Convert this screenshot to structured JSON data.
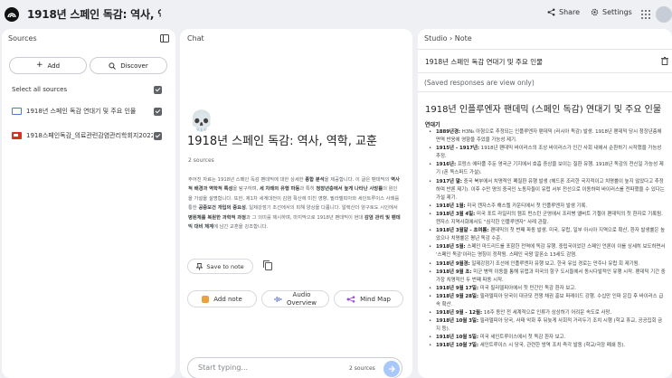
{
  "header": {
    "title": "1918년 스페인 독감: 역사, 역학, 교훈",
    "share_label": "Share",
    "settings_label": "Settings"
  },
  "sources": {
    "title": "Sources",
    "add_label": "Add",
    "discover_label": "Discover",
    "select_all_label": "Select all sources",
    "items": [
      {
        "name": "1918년 스페인 독감 연대기 및 주요 인물",
        "type": "web"
      },
      {
        "name": "1918스페인독감_의료관련감염관리학회지2022...",
        "type": "pdf"
      }
    ]
  },
  "chat": {
    "title": "Chat",
    "emoji": "💀",
    "heading": "1918년 스페인 독감: 역사, 역학, 교훈",
    "source_count": "2 sources",
    "summary_segments": [
      {
        "t": "주어진 자료는 1918년 스페인 독감 팬데믹에 대한 상세한 ",
        "b": false
      },
      {
        "t": "종합 분석",
        "b": true
      },
      {
        "t": "을 제공합니다. 이 글은 팬데믹의 ",
        "b": false
      },
      {
        "t": "역사적 배경과 역학적 특성",
        "b": true
      },
      {
        "t": "을 탐구하며, ",
        "b": false
      },
      {
        "t": "세 차례의 유행 파동",
        "b": true
      },
      {
        "t": "과 특히 ",
        "b": false
      },
      {
        "t": "청장년층에서 높게 나타난 사망률",
        "b": true
      },
      {
        "t": "의 원인을 가설을 설명합니다. 또한, 제1차 세계대전이 감염 확산에 미친 영향, 필라델피아와 세인트루이스 사례를 통한 ",
        "b": false
      },
      {
        "t": "공중보건 개입의 중요성",
        "b": true
      },
      {
        "t": ", 일제강점기 조선에서의 피해 양상을 다룹니다. 알렉산더 양구토도 시인에서 ",
        "b": false
      },
      {
        "t": "병원체를 복원한 과학적 과정",
        "b": true
      },
      {
        "t": "과 그 의미를 제시하며, 마지막으로 1918년 팬데믹이 현대 ",
        "b": false
      },
      {
        "t": "감염 관리 및 팬데믹 대비 체계",
        "b": true
      },
      {
        "t": "에 남긴 교훈을 강조합니다.",
        "b": false
      }
    ],
    "save_note_label": "Save to note",
    "chips": {
      "add_note": "Add note",
      "audio_line1": "Audio",
      "audio_line2": "Overview",
      "mind_map": "Mind Map"
    },
    "input_placeholder": "Start typing...",
    "input_source_count": "2 sources"
  },
  "studio": {
    "crumb_studio": "Studio",
    "crumb_sep": "›",
    "crumb_note": "Note",
    "note_title": "1918년 스페인 독감 연대기 및 주요 인물",
    "readonly": "(Saved responses are view only)",
    "doc_title": "1918년 인플루엔자 팬데믹 (스페인 독감) 연대기 및 주요 인물",
    "section": "연대기",
    "events": [
      {
        "date": "1889년경:",
        "text": " H3N₈ 아형으로 추정되는 인플루엔자 팬데믹 (러시아 독감) 발생. 1918년 팬데믹 당시 청장년층에 면역 반응에 영향을 주었을 가능성 제기."
      },
      {
        "date": "1915년 - 1917년:",
        "text": " 1918년 팬데믹 바이러스의 조상 바이러스가 인간 사회 내에서 순환하기 시작했을 가능성 추정."
      },
      {
        "date": "1916년:",
        "text": " 프랑스 에타플 주둔 영국군 기지에서 호흡 증상을 보이는 질환 유행. 1918년 독감의 전신일 가능성 제기 (폰 독스퍼드 가설)."
      },
      {
        "date": "1917년 말:",
        "text": " 중국 북부에서 치명적인 폐질환 유행 발생 (헤드폰 조리한 국지적이고 치명률이 높지 않았다고 추정하며 반론 제기). 이후 수만 명의 중국인 노동자들이 유럽 서부 전선으로 이동하며 바이러스를 전파했을 수 있다는 가설 제기."
      },
      {
        "date": "1918년 1월:",
        "text": " 미국 캔자스주 해스켈 카운티에서 첫 인플루엔자 발생 기록."
      },
      {
        "date": "1918년 3월 4일:",
        "text": " 미국 포트 라일리의 캠프 펀스턴 군영에서 조리병 앨버트 기첼이 팬데믹의 첫 환자로 기록됨. 캔자스 지역사회에서도 \"심각한 인플루엔자\" 사례 관찰."
      },
      {
        "date": "1918년 3월말 - 초여름:",
        "text": " 팬데믹의 첫 번째 파동 발생. 미국, 유럽, 일부 아시아 지역으로 확산, 환자 발생률은 높았으나 치명률은 평년 독감 수준."
      },
      {
        "date": "1918년 5월:",
        "text": " 스페인 마드리드를 포함한 전역에 독감 유행. 중립국이었던 스페인 언론이 이를 상세히 보도하면서 '스페인 독감'이라는 명칭이 정착됨. 스페인 국왕 알폰소 13세도 감염."
      },
      {
        "date": "1918년 9월경:",
        "text": " 일제강점기 조선에 인플루엔자 유행 보고. 한국 유입 경로는 만주나 유럽 회 제기됨."
      },
      {
        "date": "1918년 9월 초:",
        "text": " 미군 병력 이동을 통해 유럽과 미국의 항구 도시들에서 동시다발적인 유행 시작. 팬데믹 기간 중 가장 치명적인 두 번째 파동 시작."
      },
      {
        "date": "1918년 9월 17일:",
        "text": " 미국 필라델피아에서 첫 민간인 독감 환자 보고."
      },
      {
        "date": "1918년 9월 28일:",
        "text": " 필라델피아 당국이 대규모 전쟁 채권 홍보 퍼레이드 강행. 수십만 인파 운집 후 바이러스 급속 확산."
      },
      {
        "date": "1918년 9월 - 12월:",
        "text": " 16주 동안 전 세계적으로 인류가 상상하기 어려운 속도로 사망."
      },
      {
        "date": "1918년 10월 3일:",
        "text": " 필라델피아 당국, 사태 악화 후 뒤늦게 사회적 거리두기 조치 시행 (학교 휴교, 공공집회 금지 등)."
      },
      {
        "date": "1918년 10월 5일:",
        "text": " 미국 세인트루이스에서 첫 독감 환자 보고."
      },
      {
        "date": "1918년 10월 7일:",
        "text": " 세인트루이스 시 당국, 관련한 방역 조치 즉각 발동 (학교/극장 폐쇄 등)."
      }
    ]
  }
}
